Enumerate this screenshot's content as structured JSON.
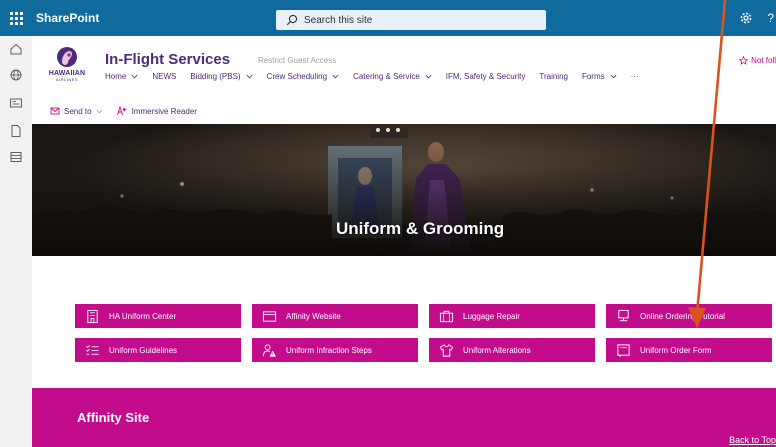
{
  "suite_bar": {
    "app_name": "SharePoint",
    "search_placeholder": "Search this site",
    "help_glyph": "?",
    "icons": [
      "app-launcher-icon",
      "search-icon",
      "settings-gear-icon",
      "help-icon"
    ]
  },
  "left_rail": {
    "icons": [
      "home-icon",
      "globe-icon",
      "news-icon",
      "document-icon",
      "list-icon"
    ]
  },
  "site": {
    "logo_text": "HAWAIIAN",
    "logo_subtext": "AIRLINES",
    "title": "In-Flight Services",
    "badge": "Restrict Guest Access",
    "follow_label": "Not foll",
    "nav": [
      {
        "label": "Home",
        "has_dropdown": true
      },
      {
        "label": "NEWS",
        "has_dropdown": false
      },
      {
        "label": "Bidding (PBS)",
        "has_dropdown": true
      },
      {
        "label": "Crew Scheduling",
        "has_dropdown": true
      },
      {
        "label": "Catering & Service",
        "has_dropdown": true
      },
      {
        "label": "IFM, Safety & Security",
        "has_dropdown": false
      },
      {
        "label": "Training",
        "has_dropdown": false
      },
      {
        "label": "Forms",
        "has_dropdown": true
      },
      {
        "label": "···",
        "has_dropdown": false
      }
    ]
  },
  "command_bar": {
    "send_to": "Send to",
    "immersive_reader": "Immersive Reader"
  },
  "hero": {
    "title": "Uniform & Grooming"
  },
  "quick_links": [
    {
      "label": "HA Uniform Center",
      "icon": "building-icon"
    },
    {
      "label": "Affinity Website",
      "icon": "website-icon"
    },
    {
      "label": "Luggage Repair",
      "icon": "luggage-icon"
    },
    {
      "label": "Online Ordering Tutorial",
      "icon": "monitor-icon"
    },
    {
      "label": "Uniform Guidelines",
      "icon": "checklist-icon"
    },
    {
      "label": "Uniform Infraction Steps",
      "icon": "person-warning-icon"
    },
    {
      "label": "Uniform Alterations",
      "icon": "shirt-icon"
    },
    {
      "label": "Uniform Order Form",
      "icon": "form-icon"
    }
  ],
  "affinity": {
    "title": "Affinity Site",
    "back_to_top": "Back to Top"
  },
  "colors": {
    "suite_bar": "#0f6a9e",
    "brand_purple": "#4b2c7a",
    "accent_magenta": "#c30c8b",
    "annotation_arrow": "#d9531e"
  }
}
